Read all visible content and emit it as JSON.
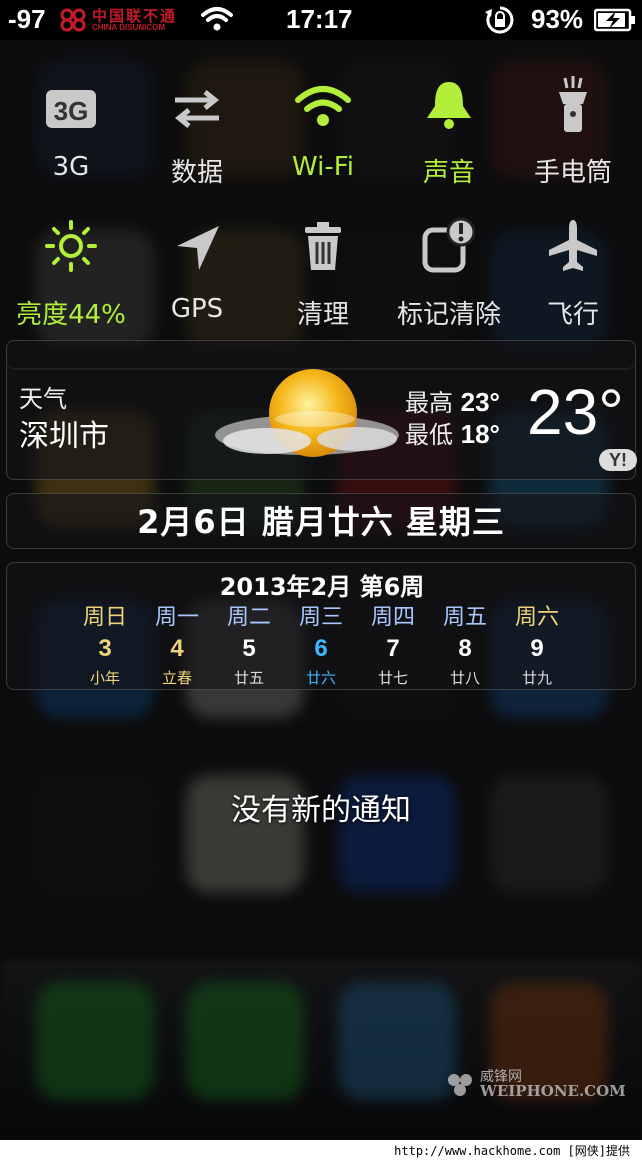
{
  "status_bar": {
    "signal": "-97",
    "carrier_cn": "中国联不通",
    "carrier_en": "CHINA DISUNICOM",
    "time": "17:17",
    "battery_percent": "93%",
    "battery_level": 0.93
  },
  "toggles": [
    {
      "label": "3G",
      "icon": "3g-icon",
      "on": false
    },
    {
      "label": "数据",
      "icon": "data-arrows-icon",
      "on": false
    },
    {
      "label": "Wi-Fi",
      "icon": "wifi-icon",
      "on": true
    },
    {
      "label": "声音",
      "icon": "bell-icon",
      "on": true
    },
    {
      "label": "手电筒",
      "icon": "flashlight-icon",
      "on": false
    },
    {
      "label": "亮度44%",
      "icon": "brightness-icon",
      "on": true
    },
    {
      "label": "GPS",
      "icon": "gps-icon",
      "on": false
    },
    {
      "label": "清理",
      "icon": "trash-icon",
      "on": false
    },
    {
      "label": "标记清除",
      "icon": "badge-clear-icon",
      "on": false
    },
    {
      "label": "飞行",
      "icon": "airplane-icon",
      "on": false
    }
  ],
  "weather": {
    "label": "天气",
    "city": "深圳市",
    "high_label": "最高",
    "high": "23°",
    "low_label": "最低",
    "low": "18°",
    "current": "23°",
    "provider": "Y!"
  },
  "date_line": "2月6日 腊月廿六 星期三",
  "calendar": {
    "title": "2013年2月 第6周",
    "days": [
      {
        "weekday": "周日",
        "date": "3",
        "lunar": "小年"
      },
      {
        "weekday": "周一",
        "date": "4",
        "lunar": "立春"
      },
      {
        "weekday": "周二",
        "date": "5",
        "lunar": "廿五"
      },
      {
        "weekday": "周三",
        "date": "6",
        "lunar": "廿六"
      },
      {
        "weekday": "周四",
        "date": "7",
        "lunar": "廿七"
      },
      {
        "weekday": "周五",
        "date": "8",
        "lunar": "廿八"
      },
      {
        "weekday": "周六",
        "date": "9",
        "lunar": "廿九"
      }
    ]
  },
  "no_notifications": "没有新的通知",
  "watermark": {
    "cn": "威锋网",
    "en": "WEIPHONE.COM"
  },
  "footer": "http://www.hackhome.com [网侠]提供",
  "colors": {
    "accent_green": "#b3ef3a",
    "today_blue": "#3ab8ff",
    "weekend_gold": "#f0d27a",
    "weekday_blue": "#a9c6ff"
  }
}
